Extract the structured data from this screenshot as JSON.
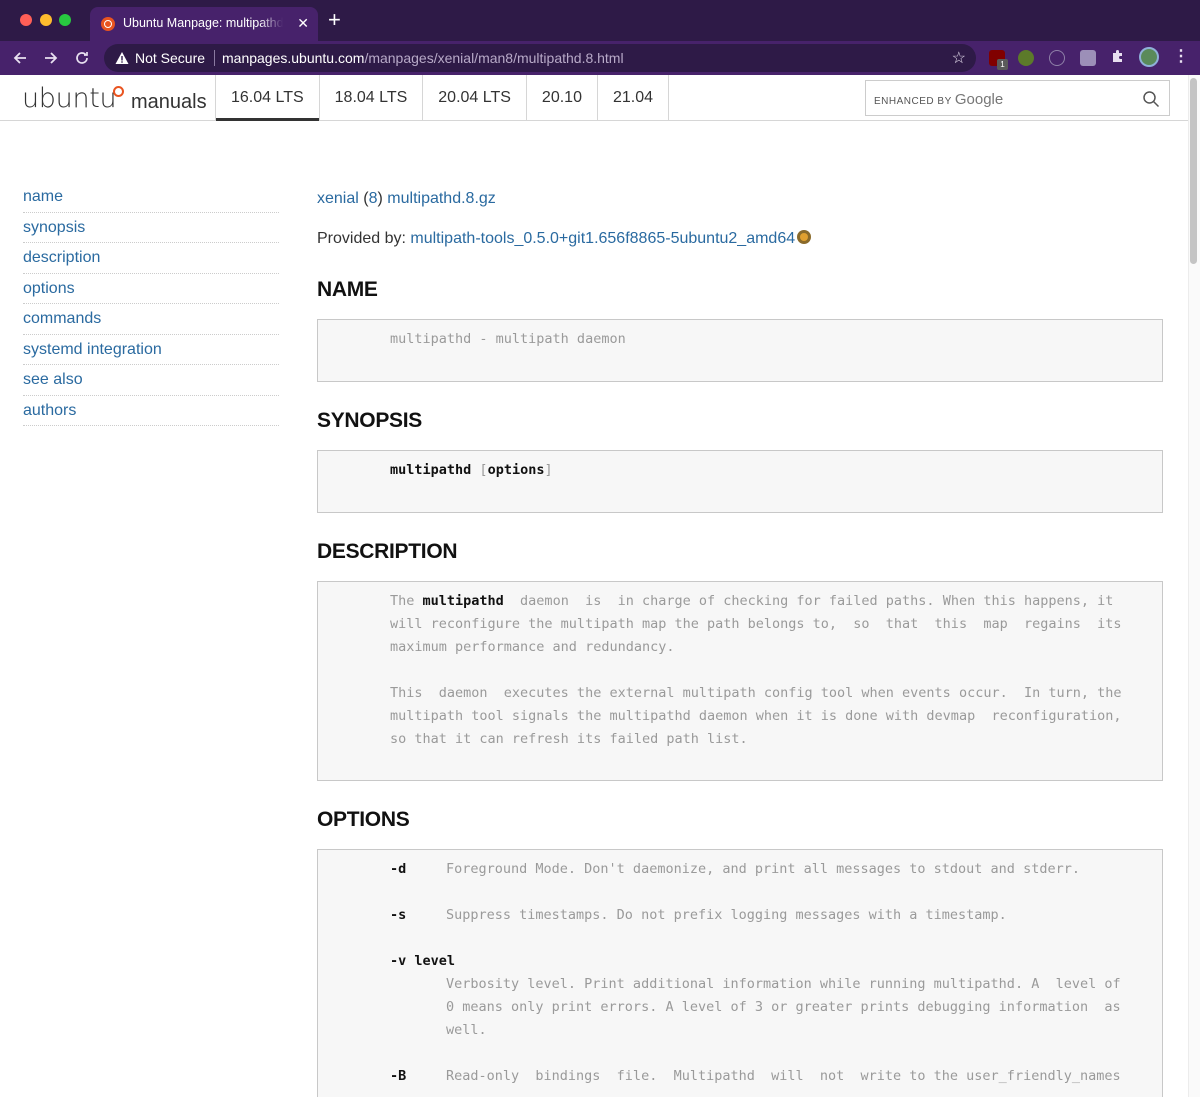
{
  "browser": {
    "tab_title": "Ubuntu Manpage: multipathd - m",
    "tab_close": "✕",
    "new_tab": "+",
    "not_secure": "Not Secure",
    "url_host": "manpages.ubuntu.com",
    "url_path": "/manpages/xenial/man8/multipathd.8.html",
    "ext_badge": "1"
  },
  "site": {
    "logo": "ubuntu",
    "logo_sub": "manuals",
    "versions": [
      "16.04 LTS",
      "18.04 LTS",
      "20.04 LTS",
      "20.10",
      "21.04"
    ],
    "active_version": "16.04 LTS",
    "search_enhanced": "ENHANCED BY",
    "search_google": "Google"
  },
  "sidebar": {
    "items": [
      "name",
      "synopsis",
      "description",
      "options",
      "commands",
      "systemd integration",
      "see also",
      "authors"
    ]
  },
  "page": {
    "crumb_release": "xenial",
    "crumb_section": "8",
    "crumb_file": "multipathd.8.gz",
    "provided_label": "Provided by:",
    "provided_pkg": "multipath-tools_0.5.0+git1.656f8865-5ubuntu2_amd64",
    "name_heading": "NAME",
    "name_text": "multipathd - multipath daemon",
    "synopsis_heading": "SYNOPSIS",
    "synopsis_cmd": "multipathd",
    "synopsis_open": "[",
    "synopsis_opt": "options",
    "synopsis_close": "]",
    "description_heading": "DESCRIPTION",
    "desc_p1_pre": "The ",
    "desc_p1_bold": "multipathd",
    "desc_p1_l1": "  daemon  is  in charge of checking for failed paths. When this happens, it",
    "desc_p1_l2": "will reconfigure the multipath map the path belongs to,  so  that  this  map  regains  its",
    "desc_p1_l3": "maximum performance and redundancy.",
    "desc_p2_l1": "This  daemon  executes the external multipath config tool when events occur.  In turn, the",
    "desc_p2_l2": "multipath tool signals the multipathd daemon when it is done with devmap  reconfiguration,",
    "desc_p2_l3": "so that it can refresh its failed path list.",
    "options_heading": "OPTIONS",
    "opt_d_flag": "-d",
    "opt_d_text": "Foreground Mode. Don't daemonize, and print all messages to stdout and stderr.",
    "opt_s_flag": "-s",
    "opt_s_text": "Suppress timestamps. Do not prefix logging messages with a timestamp.",
    "opt_v_flag": "-v level",
    "opt_v_l1": "Verbosity level. Print additional information while running multipathd. A  level of",
    "opt_v_l2": "0 means only print errors. A level of 3 or greater prints debugging information  as",
    "opt_v_l3": "well.",
    "opt_b_flag": "-B",
    "opt_b_l1": "Read-only  bindings  file.  Multipathd  will  not  write to the user_friendly_names"
  }
}
